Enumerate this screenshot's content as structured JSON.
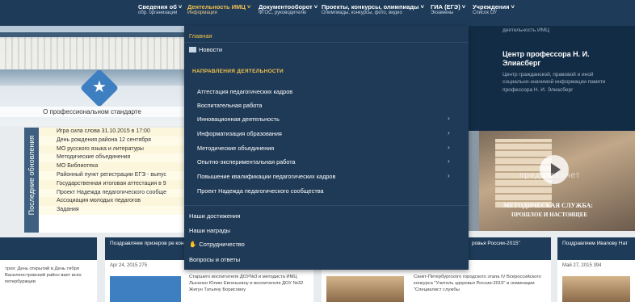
{
  "nav": [
    {
      "title": "Сведения об ˅",
      "sub": "обр. организации"
    },
    {
      "title": "Деятельность ИМЦ ˅",
      "sub": "Информация"
    },
    {
      "title": "Документооборот ˅",
      "sub": "ФГОС, руководителю"
    },
    {
      "title": "Проекты, конкурсы, олимпиады ˅",
      "sub": "Олимпиады, конкурсы, фото, видео"
    },
    {
      "title": "ГИА (ЕГЭ) ˅",
      "sub": "Экзамены"
    },
    {
      "title": "Учреждения ˅",
      "sub": "Список ОУ"
    }
  ],
  "hero": {
    "caption": "О профессиональном стандарте"
  },
  "updates": {
    "title": "Последние обновления",
    "items": [
      "Игра сила слова 31.10.2015 в 17:00",
      "День рождения района 12 сентября",
      "МО русского языка и литературы",
      "Методические объединения",
      "МО Библиотека",
      "Районный пункт регистрации ЕГЭ - выпус",
      "Государственная итоговая аттестация в 9",
      "Проект Надежда педагогического сообще",
      "Ассоциация молодых педагогов",
      "Задания"
    ]
  },
  "right_panel": {
    "sup": "деятельность ИМЦ",
    "title": "Центр профессора Н. И. Элиасберг",
    "desc": "Центр гражданской, правовой и иной социально-значимой информации памяти профессора Н. И. Элиасберг"
  },
  "right_image": {
    "presents": "представляет",
    "cap1": "МЕТОДИЧЕСКАЯ СЛУЖБА:",
    "cap2": "ПРОШЛОЕ И НАСТОЯЩЕЕ"
  },
  "dropdown": {
    "home": "Главная",
    "news": "Новости",
    "section": "НАПРАВЛЕНИЯ ДЕЯТЕЛЬНОСТИ",
    "sub_items": [
      "Аттестация педагогических кадров",
      "Воспитательная работа",
      "Инновационная деятельность",
      "Информатизация образования",
      "Методические объединения",
      "Опытно-экспериментальная работа",
      "Повышение квалификации педагогических кадров",
      "Проект Надежда педагогического сообщества"
    ],
    "arrow": "›",
    "bottom_items": [
      "Наши достижения",
      "Наши награды",
      "Сотрудничество",
      "Вопросы и ответы"
    ]
  },
  "cards": [
    {
      "head": "",
      "meta": "",
      "body": "троя: День открытий в День тября Василеостровский район вает всех петербуржцев"
    },
    {
      "head": "Поздравляем призеров ре конкурса «Воспитатели...",
      "meta": "Apr 24, 2015   275",
      "body": "Старшего воспитателя ДОУ№3 и методиста ИМЦ Лысенко Юлию Евгеньевну и воспитателя ДОУ №32 Жигун Татьяну Борисовну"
    },
    {
      "head": "ровья России-2015\"",
      "meta": "Май 23, 2015   443",
      "body": "Санкт-Петербургского городского этапа IV Всероссийского конкурса \"Учитель здоровья России-2015\" в номинации \"Специалист службы"
    },
    {
      "head": "Поздравляем Ивanову Нат",
      "meta": "Май 27, 2015   394",
      "body": ""
    }
  ]
}
